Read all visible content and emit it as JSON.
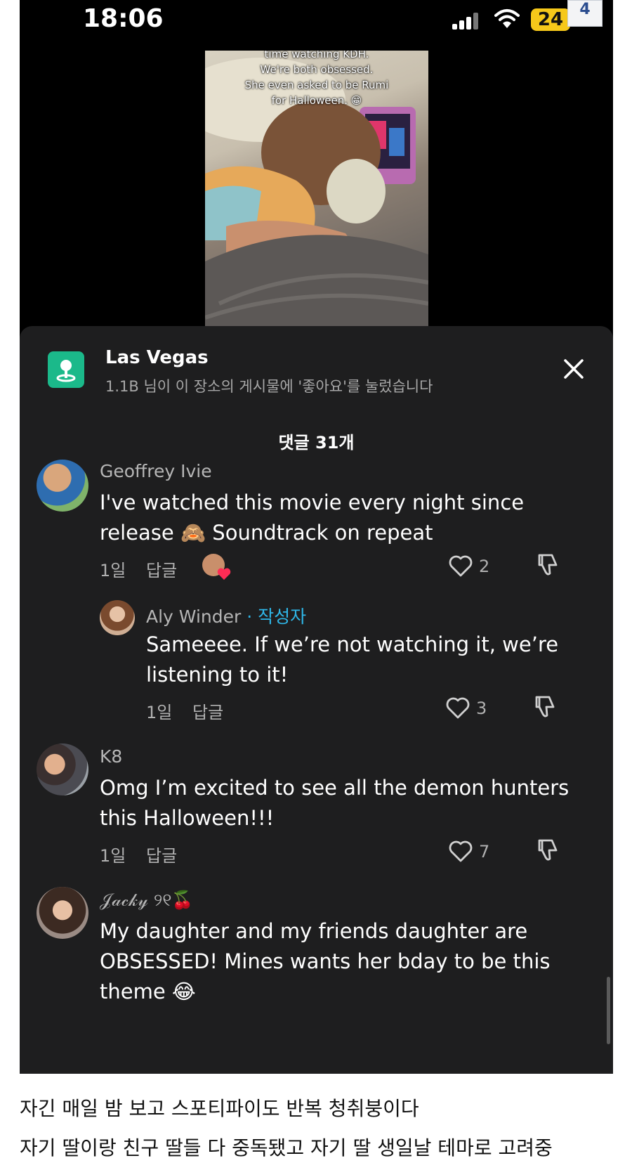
{
  "status_bar": {
    "time": "18:06",
    "battery": "24",
    "corner_badge": "4"
  },
  "video": {
    "caption_lines": [
      "time watching KDH.",
      "We're both obsessed.",
      "She even asked to be Rumi",
      "for Halloween. 😁"
    ]
  },
  "location": {
    "title": "Las Vegas",
    "subtitle": "1.1B 님이 이 장소의 게시물에 '좋아요'를 눌렀습니다"
  },
  "comments_header": "댓글 31개",
  "comments": [
    {
      "user": "Geoffrey Ivie",
      "lines": [
        "I've watched this movie every night since",
        "release 🙈 Soundtrack on repeat"
      ],
      "time": "1일",
      "reply": "답글",
      "likes": "2"
    },
    {
      "user": "Aly Winder",
      "author_tag": "· 작성자",
      "lines": [
        "Sameeee. If we’re not watching it, we’re",
        "listening to it!"
      ],
      "time": "1일",
      "reply": "답글",
      "likes": "3"
    },
    {
      "user": "K8",
      "lines": [
        "Omg I’m excited to see all the demon hunters",
        "this Halloween!!!"
      ],
      "time": "1일",
      "reply": "답글",
      "likes": "7"
    },
    {
      "user": "𝒥𝒶𝒸𝓀𝓎 ୨୧🍒",
      "lines": [
        "My daughter and my friends daughter are",
        "OBSESSED! Mines wants her bday to be this",
        "theme 😂"
      ]
    }
  ],
  "post_text": [
    "자긴 매일 밤 보고 스포티파이도 반복 청취붕이다",
    "자기 딸이랑 친구 딸들 다 중독됐고 자기 딸 생일날 테마로 고려중"
  ],
  "colors": {
    "accent": "#2fb7e8",
    "location_icon": "#1bb98a",
    "sheet": "#1e1e1f"
  }
}
